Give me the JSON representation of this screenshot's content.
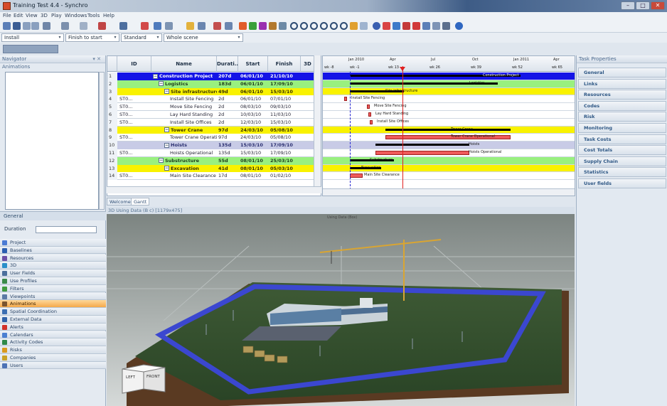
{
  "window": {
    "title": "Training Test 4.4 - Synchro",
    "controls": [
      "–",
      "□",
      "✕"
    ]
  },
  "menu": [
    "File",
    "Edit",
    "View",
    "3D",
    "Play",
    "Windows",
    "Tools",
    "Help"
  ],
  "combos": [
    {
      "value": "Install"
    },
    {
      "value": "Finish to start"
    },
    {
      "value": "Standard"
    },
    {
      "value": "Whole scene"
    }
  ],
  "navigator": {
    "title": "Navigator",
    "pin": "▾ ✕",
    "section": "Animations",
    "general": "General",
    "duration_label": "Duration"
  },
  "nav_items": [
    {
      "label": "Project",
      "color": "#4a7bd4"
    },
    {
      "label": "Baselines",
      "color": "#2b5fb0"
    },
    {
      "label": "Resources",
      "color": "#6d4fa6"
    },
    {
      "label": "3D",
      "color": "#2a8fc9"
    },
    {
      "label": "User Fields",
      "color": "#4b6f9c"
    },
    {
      "label": "Use Profiles",
      "color": "#3a8a4a"
    },
    {
      "label": "Filters",
      "color": "#3f9a3f"
    },
    {
      "label": "Viewpoints",
      "color": "#5c7aa6"
    },
    {
      "label": "Animations",
      "color": "#7a5530"
    },
    {
      "label": "Spatial Coordination",
      "color": "#3c6fb2"
    },
    {
      "label": "External Data",
      "color": "#2f62a8"
    },
    {
      "label": "Alerts",
      "color": "#d3322a"
    },
    {
      "label": "Calendars",
      "color": "#4b7fd1"
    },
    {
      "label": "Activity Codes",
      "color": "#2f8a4a"
    },
    {
      "label": "Risks",
      "color": "#d99a1f"
    },
    {
      "label": "Companies",
      "color": "#c9a227"
    },
    {
      "label": "Users",
      "color": "#4d72b5"
    }
  ],
  "active_nav": "Animations",
  "grid": {
    "headers": [
      "ID",
      "Name",
      "Durati...",
      "Start",
      "Finish",
      "3D"
    ],
    "rows": [
      {
        "num": "1",
        "id": "",
        "name": "Construction Project",
        "dur": "207d",
        "start": "06/01/10",
        "finish": "21/10/10",
        "level": "lvl0",
        "indent": 0,
        "exp": "−"
      },
      {
        "num": "2",
        "id": "",
        "name": "Logistics",
        "dur": "183d",
        "start": "06/01/10",
        "finish": "17/09/10",
        "level": "lvl1",
        "indent": 1,
        "exp": "−"
      },
      {
        "num": "3",
        "id": "",
        "name": "Site infrastructure",
        "dur": "49d",
        "start": "06/01/10",
        "finish": "15/03/10",
        "level": "lvl2",
        "indent": 2,
        "exp": "−"
      },
      {
        "num": "4",
        "id": "ST0...",
        "name": "Install Site Fencing",
        "dur": "2d",
        "start": "06/01/10",
        "finish": "07/01/10",
        "level": "task",
        "indent": 3,
        "exp": ""
      },
      {
        "num": "5",
        "id": "ST0...",
        "name": "Move Site Fencing",
        "dur": "2d",
        "start": "08/03/10",
        "finish": "09/03/10",
        "level": "task",
        "indent": 3,
        "exp": ""
      },
      {
        "num": "6",
        "id": "ST0...",
        "name": "Lay Hard Standing",
        "dur": "2d",
        "start": "10/03/10",
        "finish": "11/03/10",
        "level": "task",
        "indent": 3,
        "exp": ""
      },
      {
        "num": "7",
        "id": "ST0...",
        "name": "Install Site Offices",
        "dur": "2d",
        "start": "12/03/10",
        "finish": "15/03/10",
        "level": "task",
        "indent": 3,
        "exp": ""
      },
      {
        "num": "8",
        "id": "",
        "name": "Tower Crane",
        "dur": "97d",
        "start": "24/03/10",
        "finish": "05/08/10",
        "level": "lvl2",
        "indent": 2,
        "exp": "−"
      },
      {
        "num": "9",
        "id": "ST0...",
        "name": "Tower Crane Operati...",
        "dur": "97d",
        "start": "24/03/10",
        "finish": "05/08/10",
        "level": "task",
        "indent": 3,
        "exp": ""
      },
      {
        "num": "10",
        "id": "",
        "name": "Hoists",
        "dur": "135d",
        "start": "15/03/10",
        "finish": "17/09/10",
        "level": "lvlh",
        "indent": 2,
        "exp": "−"
      },
      {
        "num": "11",
        "id": "ST0...",
        "name": "Hoists Operational",
        "dur": "135d",
        "start": "15/03/10",
        "finish": "17/09/10",
        "level": "task",
        "indent": 3,
        "exp": ""
      },
      {
        "num": "12",
        "id": "",
        "name": "Substructure",
        "dur": "55d",
        "start": "08/01/10",
        "finish": "25/03/10",
        "level": "lvl1",
        "indent": 1,
        "exp": "−"
      },
      {
        "num": "13",
        "id": "",
        "name": "Excavation",
        "dur": "41d",
        "start": "08/01/10",
        "finish": "05/03/10",
        "level": "lvl2",
        "indent": 2,
        "exp": "−"
      },
      {
        "num": "14",
        "id": "ST0...",
        "name": "Main Site Clearance",
        "dur": "17d",
        "start": "08/01/10",
        "finish": "01/02/10",
        "level": "task",
        "indent": 3,
        "exp": ""
      }
    ]
  },
  "gantt": {
    "months": [
      "Jan 2010",
      "Apr",
      "Jul",
      "Oct",
      "Jan 2011",
      "Apr"
    ],
    "weeks": [
      "wk -8",
      "wk -1",
      "wk 13",
      "wk 26",
      "wk 39",
      "wk 52",
      "wk 65"
    ],
    "labels": {
      "r1": "Construction Project",
      "r2": "Logistics",
      "r3": "Site infrastructure",
      "r4": "Install Site Fencing",
      "r5": "Move Site Fencing",
      "r6": "Lay Hard Standing",
      "r7": "Install Site Offices",
      "r8": "Tower Crane",
      "r9": "Tower Crane Operational",
      "r10": "Hoists",
      "r11": "Hoists Operational",
      "r12": "Substructure",
      "r13": "Excavation",
      "r14": "Main Site Clearance"
    }
  },
  "tabs": [
    "Welcome",
    "Gantt"
  ],
  "view3d": {
    "title": "3D Using Data (B c) [1179x475]",
    "center_label": "Using Data (Box)",
    "cube_left": "LEFT",
    "cube_front": "FRONT"
  },
  "task_properties": {
    "title": "Task Properties",
    "items": [
      "General",
      "Links",
      "Resources",
      "Codes",
      "Risk",
      "Monitoring",
      "Task Costs",
      "Cost Totals",
      "Supply Chain",
      "Statistics",
      "User fields"
    ]
  },
  "colors": {
    "summary_blue": "#1414e6",
    "summary_green": "#99f07f",
    "summary_yellow": "#f9f200",
    "task_red": "#ef5b5b",
    "active_orange": "#f4a94a"
  }
}
